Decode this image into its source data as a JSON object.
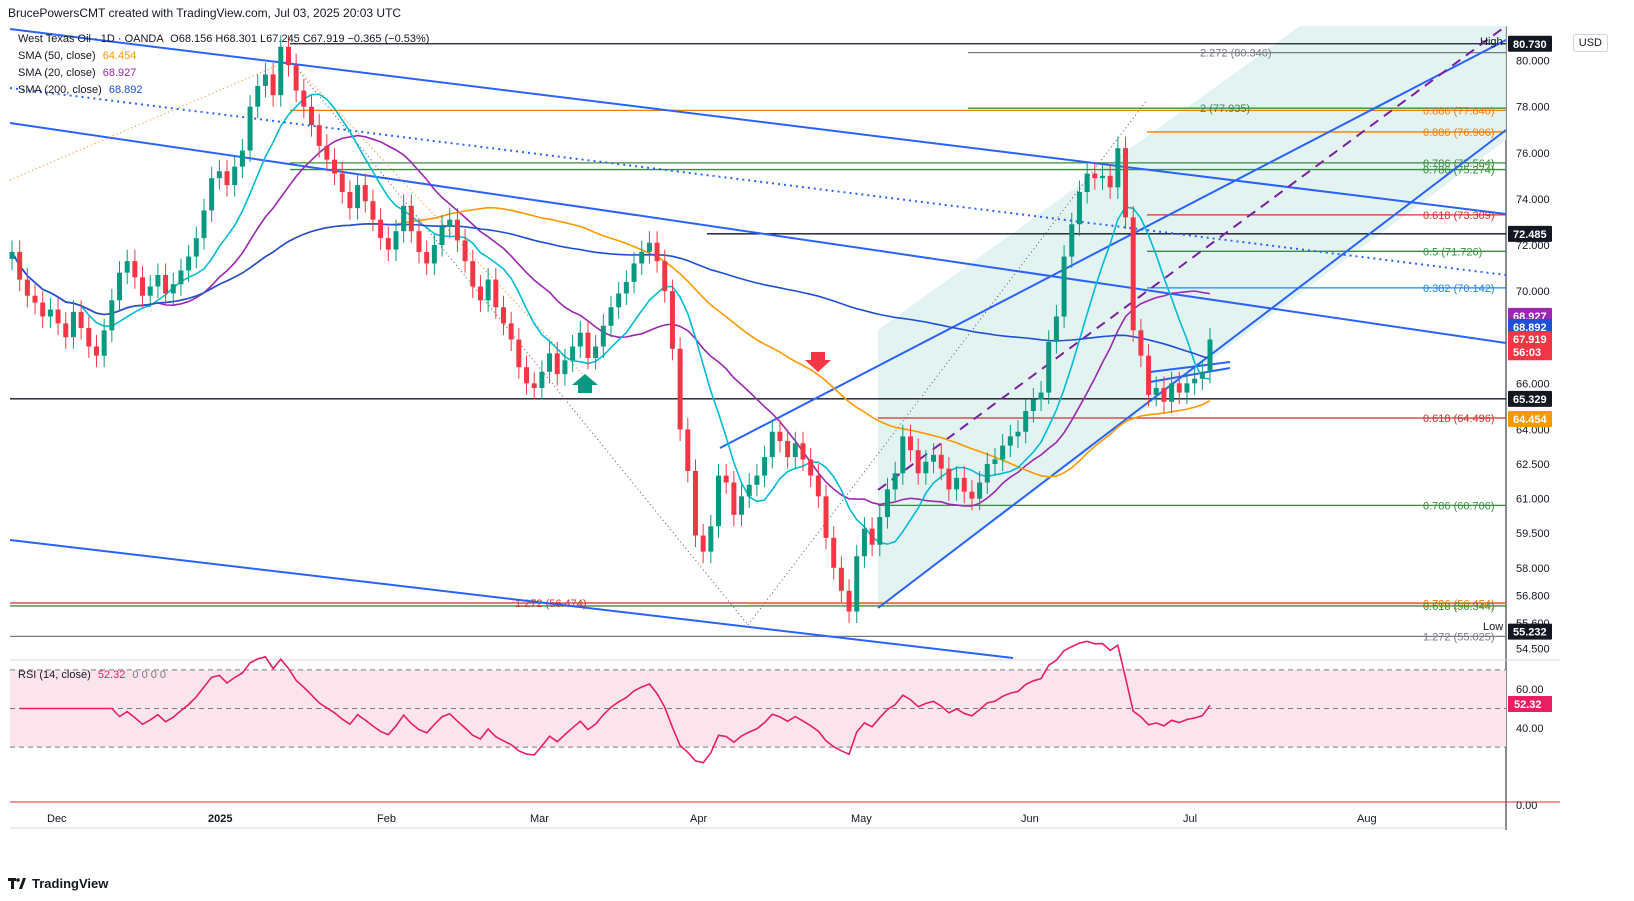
{
  "header": {
    "author_line": "BrucePowersCMT created with TradingView.com, Jul 03, 2025 20:03 UTC"
  },
  "legend": {
    "symbol": "West Texas Oil · 1D · OANDA",
    "ohlc": "O68.156  H68.301  L67.245  C67.919  −0.365 (−0.53%)",
    "sma50_label": "SMA (50, close)",
    "sma50_value": "64.454",
    "sma20_label": "SMA (20, close)",
    "sma20_value": "68.927",
    "sma200_label": "SMA (200, close)",
    "sma200_value": "68.892",
    "rsi_label": "RSI (14, close)",
    "rsi_value": "52.32",
    "rsi_extra": "0  0  0  0"
  },
  "axis": {
    "currency": "USD",
    "high_label": "High",
    "low_label": "Low"
  },
  "brand": {
    "name": "TradingView"
  },
  "colors": {
    "up": "#089981",
    "down": "#f23645",
    "sma50": "#ff9800",
    "sma20": "#9c27b0",
    "sma200": "#1e4fd6",
    "cyan": "#00bcd4",
    "trend": "#2962ff",
    "rsi": "#e91e63",
    "fib_red": "#d32f2f",
    "fib_green": "#388e3c",
    "fib_orange": "#f57c00",
    "fib_blue": "#1e88e5"
  },
  "chart_data": {
    "type": "candlestick",
    "title": "West Texas Oil · 1D · OANDA",
    "ylim": [
      54.0,
      81.5
    ],
    "y_ticks": [
      "80.000",
      "78.000",
      "76.000",
      "74.000",
      "72.000",
      "70.000",
      "66.000",
      "64.000",
      "62.500",
      "61.000",
      "59.500",
      "58.000",
      "56.800",
      "55.600",
      "54.500"
    ],
    "x_ticks": [
      "Dec",
      "2025",
      "Feb",
      "Mar",
      "Apr",
      "May",
      "Jun",
      "Jul",
      "Aug"
    ],
    "price_tags": [
      {
        "value": "80.730",
        "color": "#131722",
        "y": 80.73
      },
      {
        "value": "72.485",
        "color": "#131722",
        "y": 72.485
      },
      {
        "value": "68.927",
        "color": "#9c27b0",
        "y": 68.927
      },
      {
        "value": "68.892",
        "color": "#1e4fd6",
        "y": 68.45
      },
      {
        "value": "67.919",
        "color": "#f23645",
        "y": 67.919
      },
      {
        "value": "56:03",
        "color": "#f23645",
        "y": 67.35
      },
      {
        "value": "65.329",
        "color": "#131722",
        "y": 65.329
      },
      {
        "value": "64.454",
        "color": "#ff9800",
        "y": 64.454
      },
      {
        "value": "55.232",
        "color": "#131722",
        "y": 55.232
      }
    ],
    "fib_labels": [
      {
        "text": "2.272 (80.346)",
        "y": 80.346,
        "color": "#787b86"
      },
      {
        "text": "2 (77.935)",
        "y": 77.935,
        "color": "#388e3c"
      },
      {
        "text": "0.886 (77.840)",
        "y": 77.84,
        "color": "#f57c00"
      },
      {
        "text": "0.886 (76.906)",
        "y": 76.906,
        "color": "#f57c00"
      },
      {
        "text": "0.786 (75.564)",
        "y": 75.564,
        "color": "#388e3c"
      },
      {
        "text": "0.786 (75.274)",
        "y": 75.274,
        "color": "#388e3c"
      },
      {
        "text": "0.618 (73.309)",
        "y": 73.309,
        "color": "#d32f2f"
      },
      {
        "text": "0.5 (71.726)",
        "y": 71.726,
        "color": "#388e3c"
      },
      {
        "text": "0.382 (70.142)",
        "y": 70.142,
        "color": "#1e88e5"
      },
      {
        "text": "0.618 (64.496)",
        "y": 64.496,
        "color": "#d32f2f"
      },
      {
        "text": "0.786 (60.706)",
        "y": 60.706,
        "color": "#388e3c"
      },
      {
        "text": "1.272 (56.474)",
        "y": 56.474,
        "color": "#d32f2f"
      },
      {
        "text": "0.786 (56.454)",
        "y": 56.454,
        "color": "#f57c00"
      },
      {
        "text": "0.618 (56.344)",
        "y": 56.344,
        "color": "#388e3c"
      },
      {
        "text": "1.272 (55.025)",
        "y": 55.025,
        "color": "#787b86"
      }
    ],
    "rsi": {
      "ylim": [
        0,
        100
      ],
      "ticks": [
        "60.00",
        "40.00",
        "0.00"
      ],
      "current": "52.32"
    },
    "candles_close": [
      71.7,
      70.5,
      69.8,
      69.5,
      68.9,
      69.2,
      68.6,
      68.0,
      69.1,
      68.4,
      67.6,
      67.2,
      68.3,
      69.6,
      70.8,
      71.3,
      70.6,
      69.8,
      70.2,
      70.7,
      69.9,
      70.3,
      70.9,
      71.5,
      72.3,
      73.5,
      74.9,
      75.2,
      74.6,
      75.4,
      76.1,
      78.0,
      78.9,
      79.4,
      78.5,
      80.6,
      79.8,
      78.7,
      78.0,
      77.2,
      76.3,
      75.7,
      75.1,
      74.3,
      73.6,
      74.6,
      73.9,
      73.1,
      72.3,
      71.8,
      72.6,
      73.7,
      72.6,
      71.7,
      71.2,
      72.0,
      72.8,
      73.1,
      72.2,
      71.3,
      70.2,
      69.6,
      70.5,
      69.3,
      68.6,
      67.9,
      66.7,
      66.0,
      65.8,
      66.5,
      67.3,
      66.4,
      67.0,
      67.6,
      68.2,
      67.1,
      67.6,
      68.5,
      69.3,
      69.9,
      70.4,
      71.2,
      71.7,
      72.1,
      71.3,
      70.0,
      67.5,
      64.0,
      62.2,
      59.4,
      58.7,
      59.8,
      62.0,
      61.7,
      60.3,
      61.1,
      61.6,
      62.0,
      62.8,
      63.9,
      63.5,
      62.8,
      63.4,
      62.7,
      62.0,
      61.1,
      59.3,
      58.0,
      57.0,
      56.1,
      58.5,
      59.7,
      59.0,
      60.2,
      61.4,
      62.1,
      63.7,
      63.1,
      62.1,
      62.6,
      62.9,
      62.3,
      61.4,
      61.9,
      61.3,
      61.0,
      61.7,
      62.5,
      62.7,
      63.3,
      63.7,
      63.9,
      64.8,
      65.3,
      65.6,
      67.8,
      68.9,
      71.5,
      72.9,
      74.3,
      75.1,
      74.9,
      75.0,
      74.5,
      76.2,
      73.2,
      68.3,
      67.2,
      65.5,
      65.8,
      65.2,
      66.0,
      65.6,
      66.0,
      66.2,
      66.5,
      67.9
    ],
    "sma20_desc": "purple moving average",
    "sma50_desc": "orange moving average",
    "sma200_desc": "blue moving average"
  }
}
